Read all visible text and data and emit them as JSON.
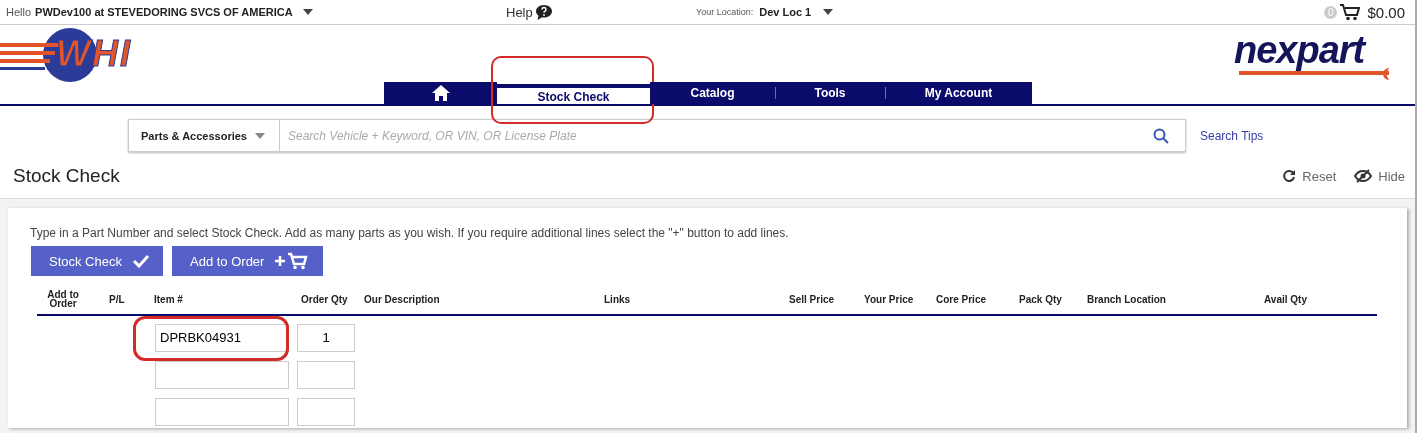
{
  "top_bar": {
    "greeting": "Hello",
    "user": "PWDev100 at STEVEDORING SVCS OF AMERICA",
    "help": "Help",
    "location_label": "Your Location:",
    "location": "Dev Loc 1",
    "cart_count": "0",
    "cart_total": "$0.00"
  },
  "logos": {
    "left": "WHI",
    "right": "nexpart"
  },
  "nav_tabs": [
    {
      "kind": "icon",
      "selected": false,
      "highlighted": false
    },
    {
      "kind": "text",
      "label": "Stock Check",
      "selected": true,
      "highlighted": true
    },
    {
      "kind": "text",
      "label": "Catalog",
      "selected": false,
      "highlighted": false
    },
    {
      "kind": "text",
      "label": "Tools",
      "selected": false,
      "highlighted": false
    },
    {
      "kind": "text",
      "label": "My Account",
      "selected": false,
      "highlighted": false
    }
  ],
  "search": {
    "category": "Parts & Accessories",
    "placeholder": "Search Vehicle + Keyword, OR VIN, OR License Plate",
    "tips": "Search Tips"
  },
  "page_title": "Stock Check",
  "actions": [
    "Reset",
    "Hide"
  ],
  "instructions": "Type in a Part Number and select Stock Check. Add as many parts as you wish. If you require additional lines select the \"+\" button to add lines.",
  "buttons": [
    {
      "kind": "check",
      "label": "Stock Check"
    },
    {
      "kind": "cart",
      "label": "Add to Order"
    }
  ],
  "table": {
    "columns": [
      "Add to Order",
      "P/L",
      "Item #",
      "Order Qty",
      "Our Description",
      "Links",
      "Sell Price",
      "Your Price",
      "Core Price",
      "Pack Qty",
      "Branch Location",
      "Avail Qty"
    ],
    "rows": [
      {
        "item_number": "DPRBK04931",
        "order_qty": "1",
        "highlighted": true
      },
      {
        "highlighted": false
      },
      {
        "highlighted": false
      }
    ]
  }
}
